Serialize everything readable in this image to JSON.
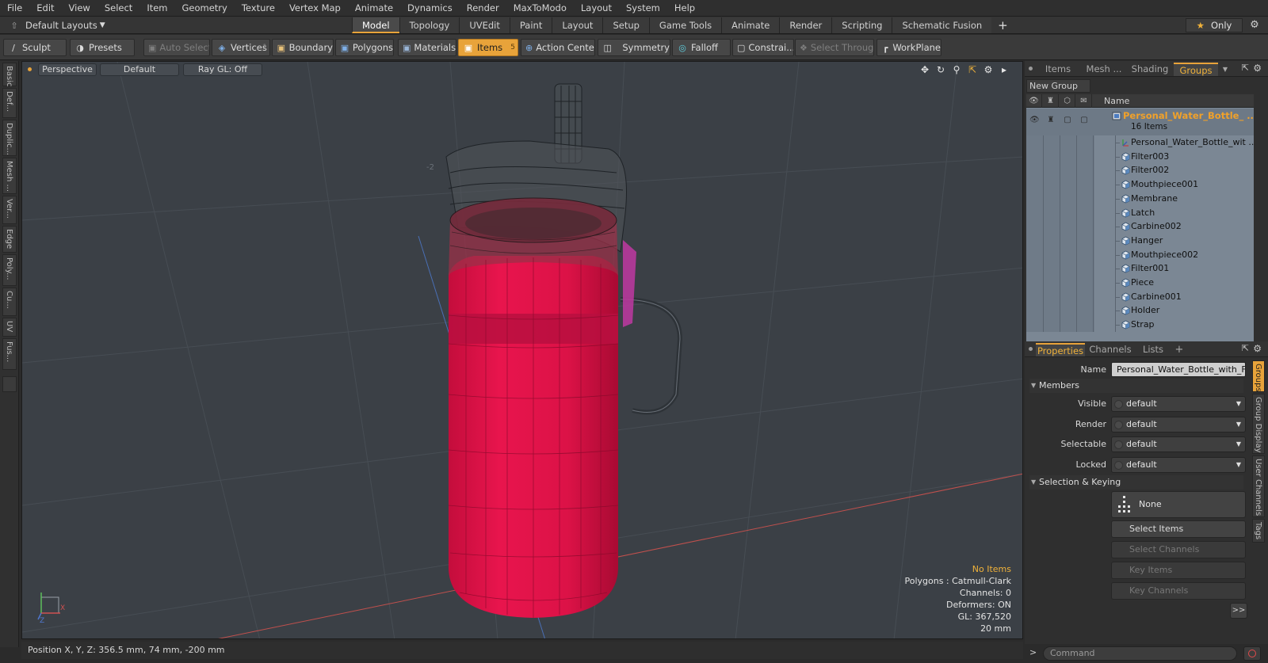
{
  "menu": [
    "File",
    "Edit",
    "View",
    "Select",
    "Item",
    "Geometry",
    "Texture",
    "Vertex Map",
    "Animate",
    "Dynamics",
    "Render",
    "MaxToModo",
    "Layout",
    "System",
    "Help"
  ],
  "layout_select": "Default Layouts",
  "main_tabs": [
    "Model",
    "Topology",
    "UVEdit",
    "Paint",
    "Layout",
    "Setup",
    "Game Tools",
    "Animate",
    "Render",
    "Scripting",
    "Schematic Fusion"
  ],
  "active_tab": "Model",
  "only_label": "Only",
  "toolbar": {
    "sculpt": "Sculpt",
    "presets": "Presets",
    "auto_select": "Auto Select",
    "vertices": "Vertices",
    "vertices_count": "1",
    "boundary": "Boundary",
    "polygons": "Polygons",
    "materials": "Materials",
    "items": "Items",
    "items_count": "5",
    "action_center": "Action Center",
    "symmetry": "Symmetry",
    "falloff": "Falloff",
    "constrain": "Constrai...",
    "select_through": "Select Through",
    "workplane": "WorkPlane"
  },
  "left_tabs": [
    "Basic",
    "Def...",
    "Duplic...",
    "Mesh ...",
    "Ver...",
    "Edge",
    "Poly...",
    "Cu...",
    "UV",
    "Fus..."
  ],
  "viewport": {
    "view": "Perspective",
    "shading": "Default",
    "raygl": "Ray GL: Off",
    "info": {
      "no_items": "No Items",
      "polygons": "Polygons : Catmull-Clark",
      "channels": "Channels: 0",
      "deformers": "Deformers: ON",
      "gl": "GL: 367,520",
      "scale": "20 mm"
    },
    "axis_x": "X",
    "axis_z": "Z",
    "grid_label": "-2",
    "colors": {
      "bottle": "#e0154a",
      "background": "#3b4046"
    }
  },
  "status": {
    "position": "Position X, Y, Z:  356.5 mm, 74 mm, -200 mm"
  },
  "right_panel": {
    "tabs": [
      "Items",
      "Mesh ...",
      "Shading",
      "Groups"
    ],
    "active_tab": "Groups",
    "new_group": "New Group",
    "tree_header_name": "Name",
    "group": {
      "name": "Personal_Water_Bottle_ ...",
      "count": "16 Items"
    },
    "items": [
      "Personal_Water_Bottle_wit ...",
      "Filter003",
      "Filter002",
      "Mouthpiece001",
      "Membrane",
      "Latch",
      "Carbine002",
      "Hanger",
      "Mouthpiece002",
      "Filter001",
      "Piece",
      "Carbine001",
      "Holder",
      "Strap"
    ]
  },
  "properties": {
    "tabs": [
      "Properties",
      "Channels",
      "Lists"
    ],
    "active_tab": "Properties",
    "name_label": "Name",
    "name_value": "Personal_Water_Bottle_with_Filte",
    "members_section": "Members",
    "visible_label": "Visible",
    "visible_value": "default",
    "render_label": "Render",
    "render_value": "default",
    "selectable_label": "Selectable",
    "selectable_value": "default",
    "locked_label": "Locked",
    "locked_value": "default",
    "selkey_section": "Selection & Keying",
    "none_value": "None",
    "select_items": "Select Items",
    "select_channels": "Select Channels",
    "key_items": "Key Items",
    "key_channels": "Key Channels",
    "more": ">>"
  },
  "side_tabs": [
    "Groups",
    "Group Display",
    "User Channels",
    "Tags"
  ],
  "command": {
    "prompt": ">",
    "placeholder": "Command"
  }
}
